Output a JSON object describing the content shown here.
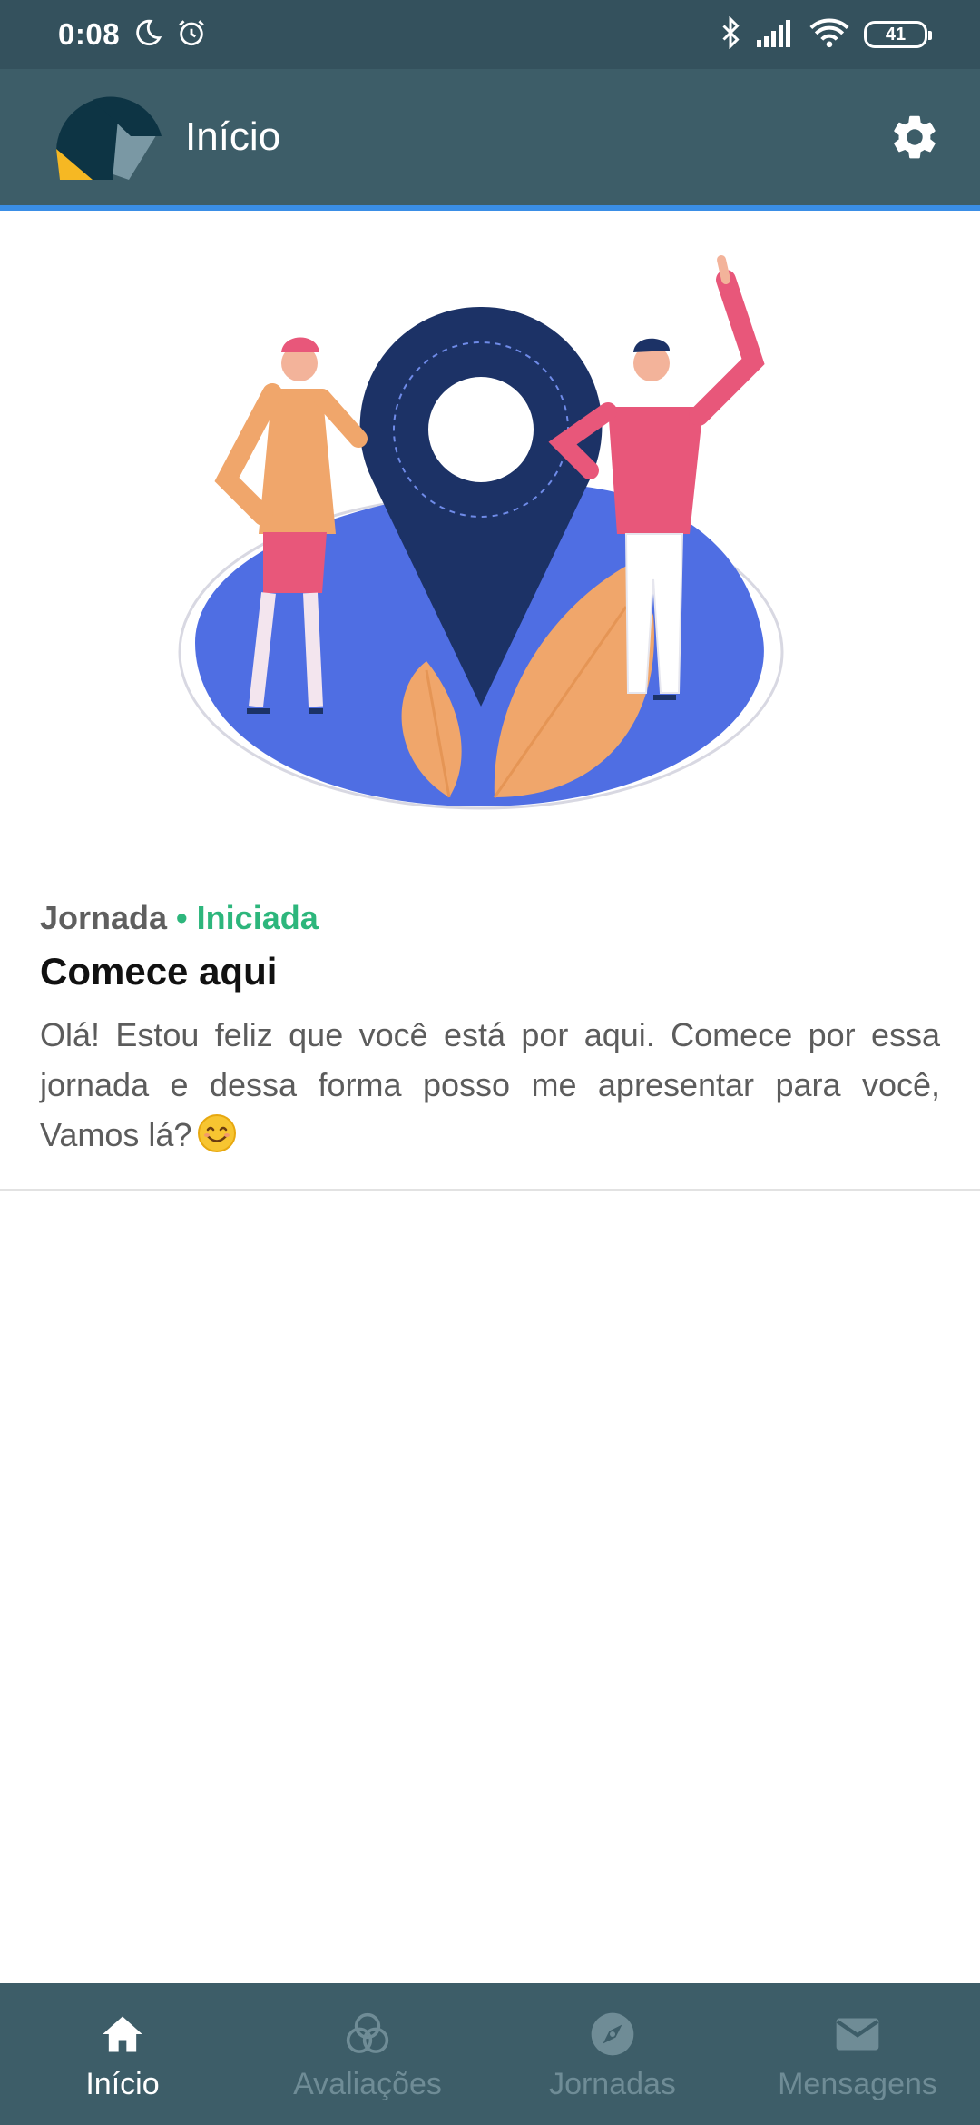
{
  "status_bar": {
    "time": "0:08",
    "battery": "41",
    "icons": [
      "moon-icon",
      "alarm-icon",
      "bluetooth-icon",
      "signal-icon",
      "wifi-icon",
      "battery-icon"
    ]
  },
  "app_bar": {
    "title": "Início",
    "settings_icon": "gear-icon"
  },
  "card": {
    "category": "Jornada",
    "separator": "•",
    "status": "Iniciada",
    "title": "Comece aqui",
    "description": "Olá! Estou feliz que você está por aqui. Comece por essa jornada e dessa forma posso me apresentar para você, Vamos lá?",
    "emoji": "smiling-face-emoji"
  },
  "bottom_nav": {
    "items": [
      {
        "label": "Início",
        "icon": "home-icon",
        "active": true
      },
      {
        "label": "Avaliações",
        "icon": "circles-icon",
        "active": false
      },
      {
        "label": "Jornadas",
        "icon": "compass-icon",
        "active": false
      },
      {
        "label": "Mensagens",
        "icon": "mail-icon",
        "active": false
      }
    ]
  },
  "colors": {
    "status_bar": "#34515d",
    "app_bar": "#3d5d68",
    "accent_line": "#3a8ee6",
    "status_green": "#2db67c",
    "nav_inactive": "#6f8c96"
  }
}
